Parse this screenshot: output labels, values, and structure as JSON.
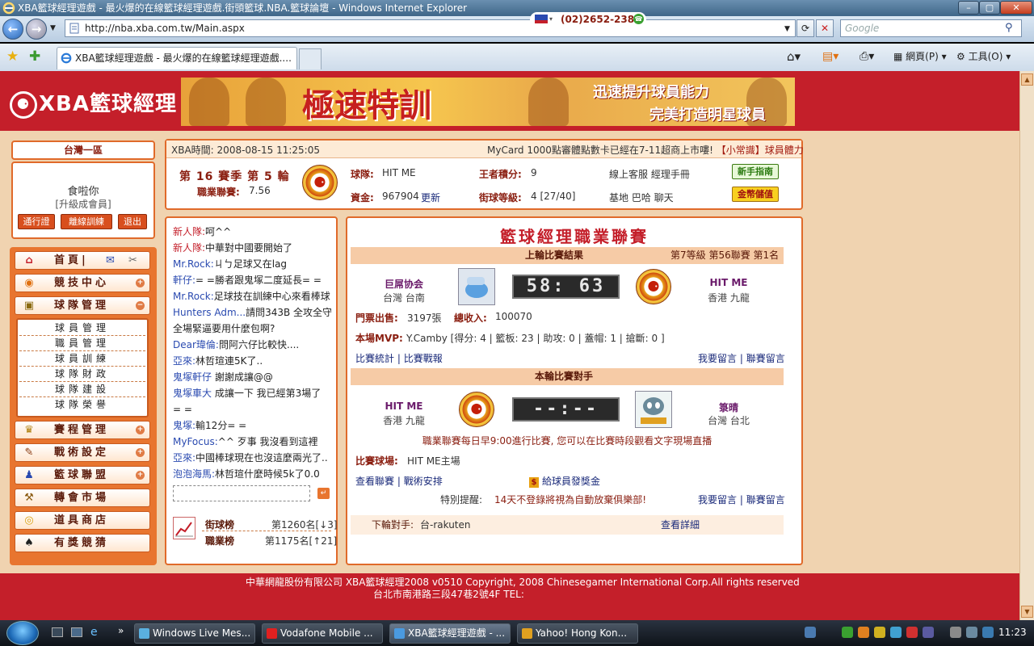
{
  "window": {
    "title": "XBA籃球經理遊戲 - 最火爆的在線籃球經理遊戲.街頭籃球.NBA.籃球論壇 - Windows Internet Explorer",
    "url": "http://nba.xba.com.tw/Main.aspx",
    "search_placeholder": "Google",
    "tab_title": "XBA籃球經理遊戲 - 最火爆的在線籃球經理遊戲....",
    "toolbar_page": "網頁(P)",
    "toolbar_tools": "工具(O)"
  },
  "header": {
    "logo": "XBA籃球經理",
    "banner_main": "極速特訓",
    "banner_line1": "迅速提升球員能力",
    "banner_line2": "完美打造明星球員"
  },
  "user": {
    "region": "台灣一區",
    "name": "食啦你",
    "level": "[升級成會員]",
    "buttons": [
      "通行證",
      "離線訓練",
      "退出"
    ]
  },
  "menu": {
    "home": "首頁",
    "items": [
      {
        "label": "競技中心",
        "icon": "basketball-icon",
        "glyph": "◉"
      },
      {
        "label": "球隊管理",
        "icon": "clipboard-icon",
        "glyph": "▣"
      }
    ],
    "submenu": [
      "球員管理",
      "職員管理",
      "球員訓練",
      "球隊財政",
      "球隊建設",
      "球隊榮譽"
    ],
    "items2": [
      {
        "label": "賽程管理",
        "icon": "trophy-icon",
        "glyph": "♛"
      },
      {
        "label": "戰術設定",
        "icon": "tactics-icon",
        "glyph": "✎"
      },
      {
        "label": "籃球聯盟",
        "icon": "people-icon",
        "glyph": "♟"
      },
      {
        "label": "轉會市場",
        "icon": "hammer-icon",
        "glyph": "⚒"
      },
      {
        "label": "道具商店",
        "icon": "coins-icon",
        "glyph": "◎"
      },
      {
        "label": "有獎競猜",
        "icon": "spade-icon",
        "glyph": "♠"
      }
    ]
  },
  "info": {
    "time_label": "XBA時間:",
    "time_value": "2008-08-15 11:25:05",
    "ticker_text": "MyCard 1000點審體點數卡已經在7-11超商上市嘍! ",
    "ticker_tip": "【小常識】球員體力",
    "season_text": "第 16 賽季  第 5 輪",
    "league_label": "職業聯賽:",
    "league_value": "7.56",
    "team_label": "球隊:",
    "team_value": "HIT ME",
    "funds_label": "資金:",
    "funds_value": "967904",
    "refresh_link": "更新",
    "score_label": "王者積分:",
    "score_value": "9",
    "level_label": "街球等級:",
    "level_value": "4 [27/40]",
    "links1": "線上客服  經理手冊",
    "links2": "基地  巴哈  聊天",
    "newbie_btn": "新手指南",
    "gold_btn": "金幣儲值"
  },
  "chat": [
    {
      "name": "新人隊:",
      "text": "呵^^",
      "style": "nm"
    },
    {
      "name": "新人隊:",
      "text": "中華對中國要開始了",
      "style": "nm"
    },
    {
      "name": "Mr.Rock:",
      "text": "ㄐㄅ足球又在lag",
      "style": "nmb"
    },
    {
      "name": "軒仔:",
      "text": "= =勝者跟鬼塚二度延長= =",
      "style": "nmb"
    },
    {
      "name": "Mr.Rock:",
      "text": "足球技在訓練中心來看棒球",
      "style": "nmb"
    },
    {
      "name": "Hunters Adm...",
      "text": "請問343B 全攻全守",
      "style": "nmb"
    },
    {
      "name": "",
      "text": "全場緊逼要用什麼包啊?",
      "style": "nmb"
    },
    {
      "name": "Dear瑋倫:",
      "text": "問阿六仔比較快....",
      "style": "nmb"
    },
    {
      "name": "亞來:",
      "text": "林哲瑄連5K了..",
      "style": "nmb"
    },
    {
      "name": "鬼塚軒仔",
      "text": " 謝謝成讓@@",
      "style": "nmb"
    },
    {
      "name": "鬼塚車大",
      "text": " 成讓一下 我已經第3場了",
      "style": "nmb"
    },
    {
      "name": "",
      "text": "= =",
      "style": "nmb"
    },
    {
      "name": "鬼塚:",
      "text": "輸12分= =",
      "style": "nmb"
    },
    {
      "name": "MyFocus:",
      "text": "^^ 歹事 我沒看到這裡",
      "style": "nmb"
    },
    {
      "name": "亞來:",
      "text": "中國棒球現在也沒這麼兩光了..",
      "style": "nmb"
    },
    {
      "name": "泡泡海馬:",
      "text": "林哲瑄什麼時候5k了0.0",
      "style": "nmb"
    }
  ],
  "ranks": {
    "street_label": "街球榜",
    "street_value": "第1260名[↓3]",
    "pro_label": "職業榜",
    "pro_value": "第1175名[↑21]"
  },
  "main": {
    "title": "籃球經理職業聯賽",
    "last_header": "上輪比賽結果",
    "last_info": "第7等級  第56聯賽  第1名",
    "home_team": "巨屌协会",
    "home_loc": "台灣  台南",
    "last_score": "58: 63",
    "away_team": "HIT ME",
    "away_loc": "香港  九龍",
    "tickets_label": "門票出售:",
    "tickets_value": "3197張",
    "income_label": "總收入:",
    "income_value": "100070",
    "mvp_label": "本場MVP:",
    "mvp_value": "Y.Camby [得分: 4 | 籃板: 23 | 助攻: 0 | 蓋帽: 1 | 搶斷: 0 ]",
    "link_stats": "比賽統計",
    "link_report": "比賽戰報",
    "link_msg": "我要留言",
    "link_league_msg": "聯賽留言",
    "next_header": "本輪比賽對手",
    "next_home": "HIT ME",
    "next_home_loc": "香港  九龍",
    "next_score": "--:--",
    "next_away": "箓晴",
    "next_away_loc": "台灣  台北",
    "schedule_note": "職業聯賽每日早9:00進行比賽, 您可以在比賽時段觀看文字現場直播",
    "venue_label": "比賽球場:",
    "venue_value": "HIT ME主場",
    "link_view_league": "查看聯賽",
    "link_tactics": "戰術安排",
    "link_bonus": "給球員發獎金",
    "reminder_label": "特別提醒:",
    "reminder_text": "14天不登錄將視為自動放棄俱樂部!",
    "next_opp_label": "下輪對手:",
    "next_opp_value": "台-rakuten",
    "link_details": "查看詳細"
  },
  "footer": {
    "line1": "中華網龍股份有限公司  XBA籃球經理2008 v0510    Copyright, 2008 Chinesegamer International Corp.All rights reserved",
    "line2": "台北市南港路三段47巷2號4F  TEL:",
    "tel": "(02)2652-2381"
  },
  "taskbar": {
    "items": [
      "Windows Live Mes...",
      "Vodafone Mobile ...",
      "XBA籃球經理遊戲 - ...",
      "Yahoo! Hong Kon..."
    ],
    "clock": "11:23"
  },
  "colors": {
    "brand": "#c41f2a",
    "accent": "#e06a2a"
  }
}
